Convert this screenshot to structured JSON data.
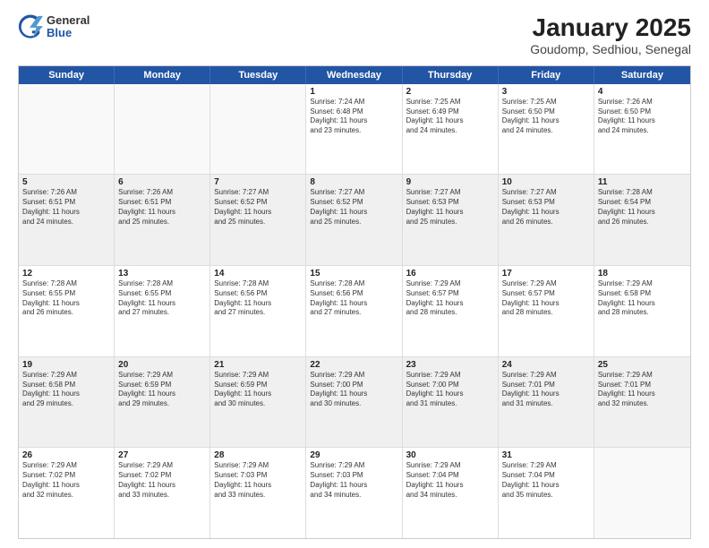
{
  "header": {
    "logo_general": "General",
    "logo_blue": "Blue",
    "title": "January 2025",
    "subtitle": "Goudomp, Sedhiou, Senegal"
  },
  "days": [
    "Sunday",
    "Monday",
    "Tuesday",
    "Wednesday",
    "Thursday",
    "Friday",
    "Saturday"
  ],
  "weeks": [
    [
      {
        "day": "",
        "info": ""
      },
      {
        "day": "",
        "info": ""
      },
      {
        "day": "",
        "info": ""
      },
      {
        "day": "1",
        "info": "Sunrise: 7:24 AM\nSunset: 6:48 PM\nDaylight: 11 hours\nand 23 minutes."
      },
      {
        "day": "2",
        "info": "Sunrise: 7:25 AM\nSunset: 6:49 PM\nDaylight: 11 hours\nand 24 minutes."
      },
      {
        "day": "3",
        "info": "Sunrise: 7:25 AM\nSunset: 6:50 PM\nDaylight: 11 hours\nand 24 minutes."
      },
      {
        "day": "4",
        "info": "Sunrise: 7:26 AM\nSunset: 6:50 PM\nDaylight: 11 hours\nand 24 minutes."
      }
    ],
    [
      {
        "day": "5",
        "info": "Sunrise: 7:26 AM\nSunset: 6:51 PM\nDaylight: 11 hours\nand 24 minutes."
      },
      {
        "day": "6",
        "info": "Sunrise: 7:26 AM\nSunset: 6:51 PM\nDaylight: 11 hours\nand 25 minutes."
      },
      {
        "day": "7",
        "info": "Sunrise: 7:27 AM\nSunset: 6:52 PM\nDaylight: 11 hours\nand 25 minutes."
      },
      {
        "day": "8",
        "info": "Sunrise: 7:27 AM\nSunset: 6:52 PM\nDaylight: 11 hours\nand 25 minutes."
      },
      {
        "day": "9",
        "info": "Sunrise: 7:27 AM\nSunset: 6:53 PM\nDaylight: 11 hours\nand 25 minutes."
      },
      {
        "day": "10",
        "info": "Sunrise: 7:27 AM\nSunset: 6:53 PM\nDaylight: 11 hours\nand 26 minutes."
      },
      {
        "day": "11",
        "info": "Sunrise: 7:28 AM\nSunset: 6:54 PM\nDaylight: 11 hours\nand 26 minutes."
      }
    ],
    [
      {
        "day": "12",
        "info": "Sunrise: 7:28 AM\nSunset: 6:55 PM\nDaylight: 11 hours\nand 26 minutes."
      },
      {
        "day": "13",
        "info": "Sunrise: 7:28 AM\nSunset: 6:55 PM\nDaylight: 11 hours\nand 27 minutes."
      },
      {
        "day": "14",
        "info": "Sunrise: 7:28 AM\nSunset: 6:56 PM\nDaylight: 11 hours\nand 27 minutes."
      },
      {
        "day": "15",
        "info": "Sunrise: 7:28 AM\nSunset: 6:56 PM\nDaylight: 11 hours\nand 27 minutes."
      },
      {
        "day": "16",
        "info": "Sunrise: 7:29 AM\nSunset: 6:57 PM\nDaylight: 11 hours\nand 28 minutes."
      },
      {
        "day": "17",
        "info": "Sunrise: 7:29 AM\nSunset: 6:57 PM\nDaylight: 11 hours\nand 28 minutes."
      },
      {
        "day": "18",
        "info": "Sunrise: 7:29 AM\nSunset: 6:58 PM\nDaylight: 11 hours\nand 28 minutes."
      }
    ],
    [
      {
        "day": "19",
        "info": "Sunrise: 7:29 AM\nSunset: 6:58 PM\nDaylight: 11 hours\nand 29 minutes."
      },
      {
        "day": "20",
        "info": "Sunrise: 7:29 AM\nSunset: 6:59 PM\nDaylight: 11 hours\nand 29 minutes."
      },
      {
        "day": "21",
        "info": "Sunrise: 7:29 AM\nSunset: 6:59 PM\nDaylight: 11 hours\nand 30 minutes."
      },
      {
        "day": "22",
        "info": "Sunrise: 7:29 AM\nSunset: 7:00 PM\nDaylight: 11 hours\nand 30 minutes."
      },
      {
        "day": "23",
        "info": "Sunrise: 7:29 AM\nSunset: 7:00 PM\nDaylight: 11 hours\nand 31 minutes."
      },
      {
        "day": "24",
        "info": "Sunrise: 7:29 AM\nSunset: 7:01 PM\nDaylight: 11 hours\nand 31 minutes."
      },
      {
        "day": "25",
        "info": "Sunrise: 7:29 AM\nSunset: 7:01 PM\nDaylight: 11 hours\nand 32 minutes."
      }
    ],
    [
      {
        "day": "26",
        "info": "Sunrise: 7:29 AM\nSunset: 7:02 PM\nDaylight: 11 hours\nand 32 minutes."
      },
      {
        "day": "27",
        "info": "Sunrise: 7:29 AM\nSunset: 7:02 PM\nDaylight: 11 hours\nand 33 minutes."
      },
      {
        "day": "28",
        "info": "Sunrise: 7:29 AM\nSunset: 7:03 PM\nDaylight: 11 hours\nand 33 minutes."
      },
      {
        "day": "29",
        "info": "Sunrise: 7:29 AM\nSunset: 7:03 PM\nDaylight: 11 hours\nand 34 minutes."
      },
      {
        "day": "30",
        "info": "Sunrise: 7:29 AM\nSunset: 7:04 PM\nDaylight: 11 hours\nand 34 minutes."
      },
      {
        "day": "31",
        "info": "Sunrise: 7:29 AM\nSunset: 7:04 PM\nDaylight: 11 hours\nand 35 minutes."
      },
      {
        "day": "",
        "info": ""
      }
    ]
  ]
}
